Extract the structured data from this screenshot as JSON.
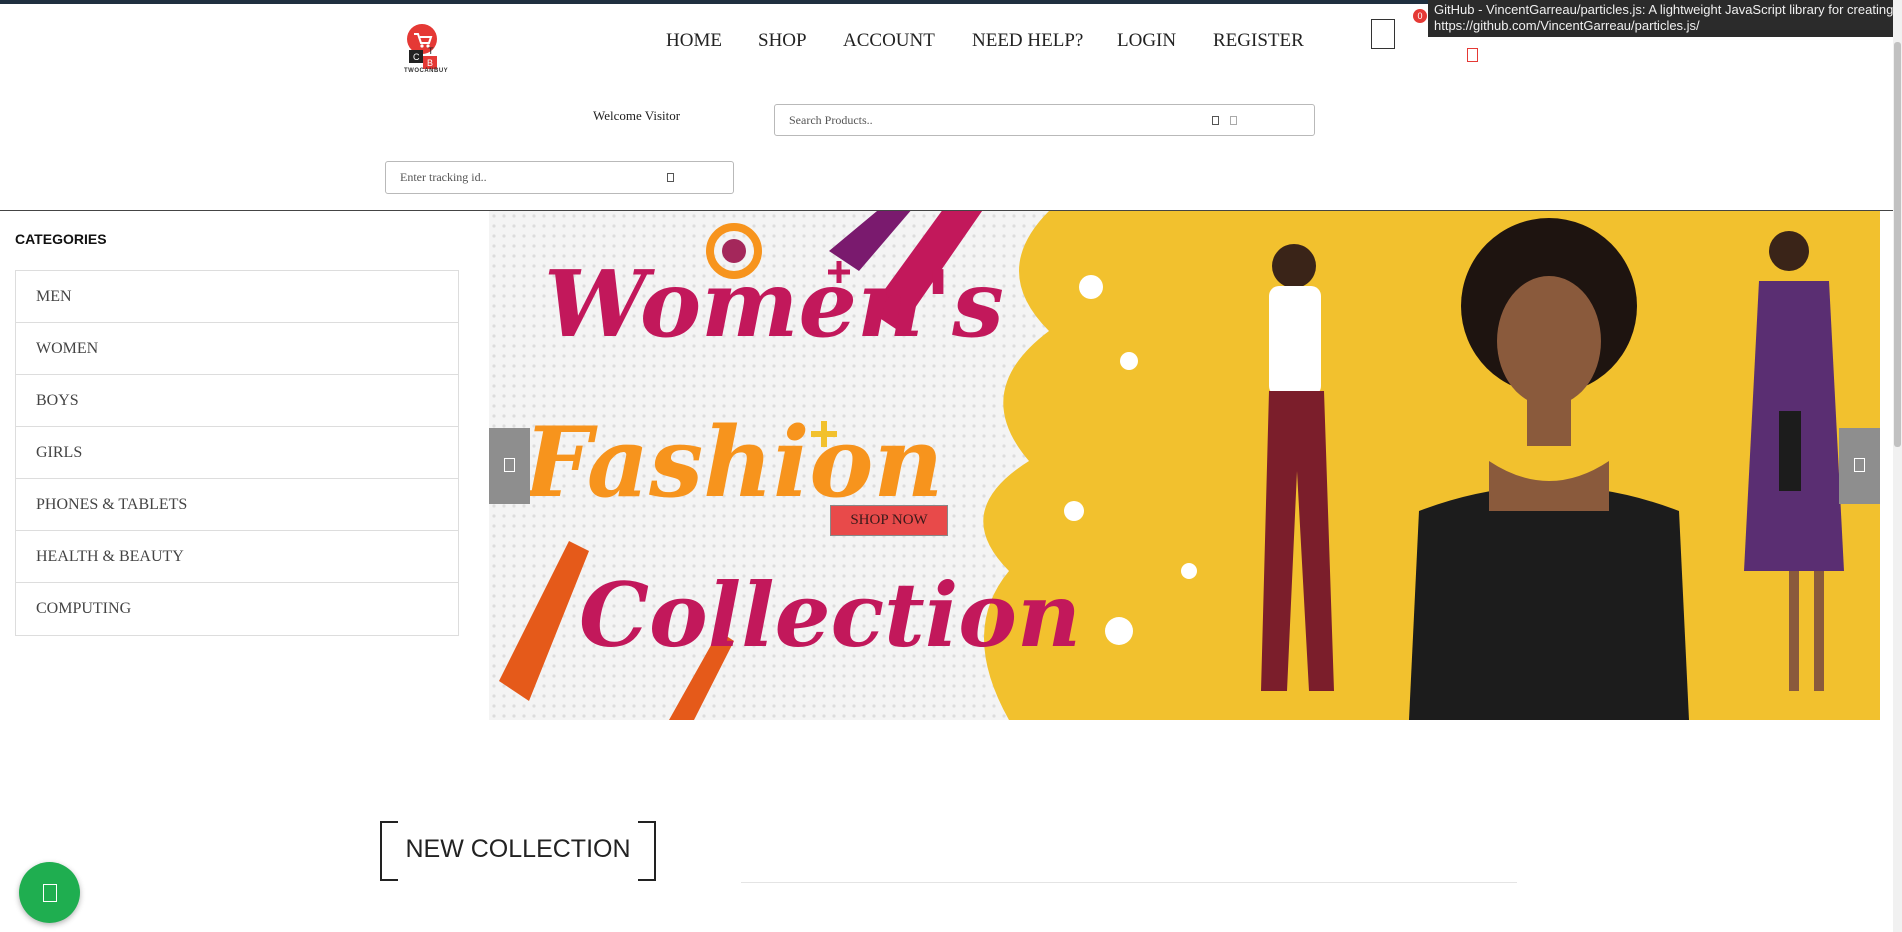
{
  "tooltip": {
    "title": "GitHub - VincentGarreau/particles.js: A lightweight JavaScript library for creating particles",
    "url": "https://github.com/VincentGarreau/particles.js/"
  },
  "logo": {
    "letters": [
      "T",
      "C",
      "B"
    ],
    "text": "TWOCANBUY"
  },
  "nav": {
    "home": "HOME",
    "shop": "SHOP",
    "account": "ACCOUNT",
    "help": "NEED HELP?",
    "login": "LOGIN",
    "register": "REGISTER"
  },
  "cart": {
    "count": "0"
  },
  "welcome": "Welcome Visitor",
  "search": {
    "placeholder": "Search Products.."
  },
  "tracking": {
    "placeholder": "Enter tracking id.."
  },
  "categories": {
    "title": "CATEGORIES",
    "items": [
      "MEN",
      "WOMEN",
      "BOYS",
      "GIRLS",
      "PHONES & TABLETS",
      "HEALTH & BEAUTY",
      "COMPUTING"
    ]
  },
  "banner": {
    "line1": "Women's",
    "line2": "Fashion",
    "line3": "Collection",
    "cta": "SHOP NOW"
  },
  "section": {
    "title": "NEW COLLECTION"
  },
  "colors": {
    "accent_red": "#e84a4a",
    "banner_yellow": "#f2c12e",
    "banner_pink": "#c2185b",
    "banner_orange": "#f7941d",
    "whatsapp_green": "#1fae50"
  }
}
